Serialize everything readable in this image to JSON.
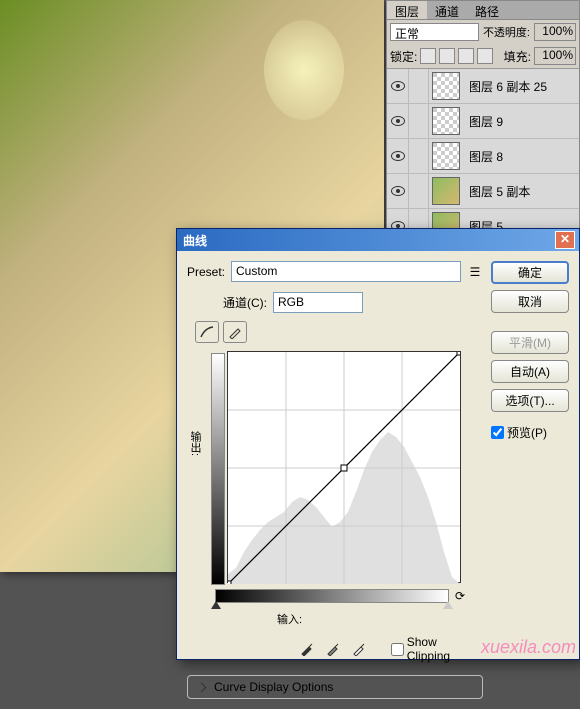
{
  "layers_panel": {
    "tabs": [
      "图层",
      "通道",
      "路径"
    ],
    "blend_mode": "正常",
    "opacity_label": "不透明度:",
    "opacity_value": "100%",
    "lock_label": "锁定:",
    "fill_label": "填充:",
    "fill_value": "100%",
    "items": [
      {
        "name": "图层 6 副本 25",
        "thumb": "checker"
      },
      {
        "name": "图层 9",
        "thumb": "checker"
      },
      {
        "name": "图层 8",
        "thumb": "checker"
      },
      {
        "name": "图层 5 副本",
        "thumb": "img"
      },
      {
        "name": "图层 5",
        "thumb": "img"
      }
    ]
  },
  "curves_dialog": {
    "title": "曲线",
    "preset_label": "Preset:",
    "preset_value": "Custom",
    "channel_label": "通道(C):",
    "channel_value": "RGB",
    "output_label": "输出:",
    "input_label": "输入:",
    "show_clip_label": "Show Clipping",
    "display_opts_label": "Curve Display Options",
    "buttons": {
      "ok": "确定",
      "cancel": "取消",
      "smooth": "平滑(M)",
      "auto": "自动(A)",
      "options": "选项(T)..."
    },
    "preview_label": "预览(P)",
    "preview_checked": true
  },
  "watermark": "xuexila.com",
  "chart_data": {
    "type": "line",
    "title": "曲线",
    "xlabel": "输入",
    "ylabel": "输出",
    "xlim": [
      0,
      255
    ],
    "ylim": [
      0,
      255
    ],
    "series": [
      {
        "name": "RGB",
        "values": [
          [
            0,
            0
          ],
          [
            126,
            126
          ],
          [
            255,
            255
          ]
        ]
      }
    ],
    "histogram_approx": [
      0,
      0,
      0,
      5,
      10,
      15,
      25,
      35,
      40,
      45,
      55,
      60,
      65,
      55,
      50,
      45,
      40,
      45,
      60,
      75,
      90,
      95,
      100,
      95,
      90,
      80,
      75,
      70,
      50,
      30,
      10,
      0
    ]
  }
}
